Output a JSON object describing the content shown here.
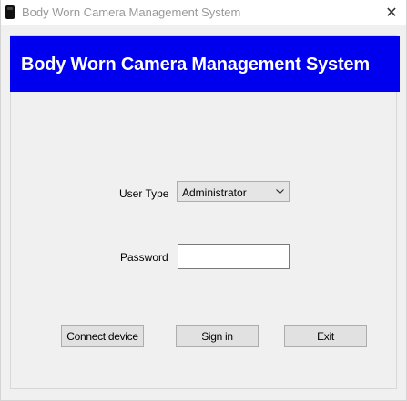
{
  "window": {
    "title": "Body Worn Camera Management System",
    "close_glyph": "✕",
    "icon": "camera-icon"
  },
  "banner": {
    "title": "Body Worn Camera Management System",
    "color": "#0000ee"
  },
  "form": {
    "user_type_label": "User Type",
    "user_type_value": "Administrator",
    "password_label": "Password",
    "password_value": ""
  },
  "buttons": {
    "connect_label": "Connect device",
    "signin_label": "Sign in",
    "exit_label": "Exit"
  }
}
